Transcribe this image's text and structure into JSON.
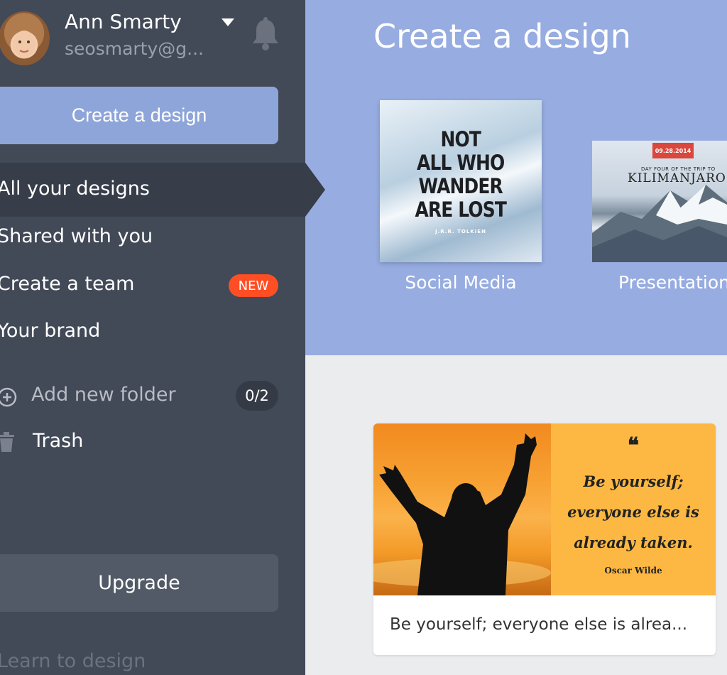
{
  "user": {
    "name": "Ann Smarty",
    "email": "seosmarty@g..."
  },
  "sidebar": {
    "create_button": "Create a design",
    "nav": [
      {
        "label": "All your designs",
        "active": true
      },
      {
        "label": "Shared with you"
      },
      {
        "label": "Create a team",
        "badge": "NEW"
      },
      {
        "label": "Your brand"
      }
    ],
    "folder": {
      "label": "Add new folder",
      "count": "0/2"
    },
    "trash": {
      "label": "Trash"
    },
    "upgrade": "Upgrade",
    "learn": "Learn to design"
  },
  "hero": {
    "title": "Create a design",
    "tiles": [
      {
        "label": "Social Media",
        "thumb_lines": [
          "NOT",
          "ALL WHO",
          "WANDER",
          "ARE LOST"
        ],
        "thumb_author": "J.R.R. TOLKIEN"
      },
      {
        "label": "Presentation",
        "thumb_date": "09.28.2014",
        "thumb_sub": "DAY FOUR OF THE TRIP TO",
        "thumb_main": "KILIMANJARO"
      }
    ]
  },
  "design_card": {
    "quote_mark": "❝",
    "quote_lines": [
      "Be yourself;",
      "everyone else is",
      "already taken."
    ],
    "author": "Oscar Wilde",
    "title": "Be yourself; everyone else is alrea..."
  },
  "colors": {
    "sidebar_bg": "#424957",
    "hero_bg": "#97ace0",
    "accent_button": "#8ea5d9",
    "badge_new": "#ff4e24"
  },
  "icons": [
    "caret-down-icon",
    "bell-icon",
    "plus-circle-icon",
    "trash-icon"
  ]
}
